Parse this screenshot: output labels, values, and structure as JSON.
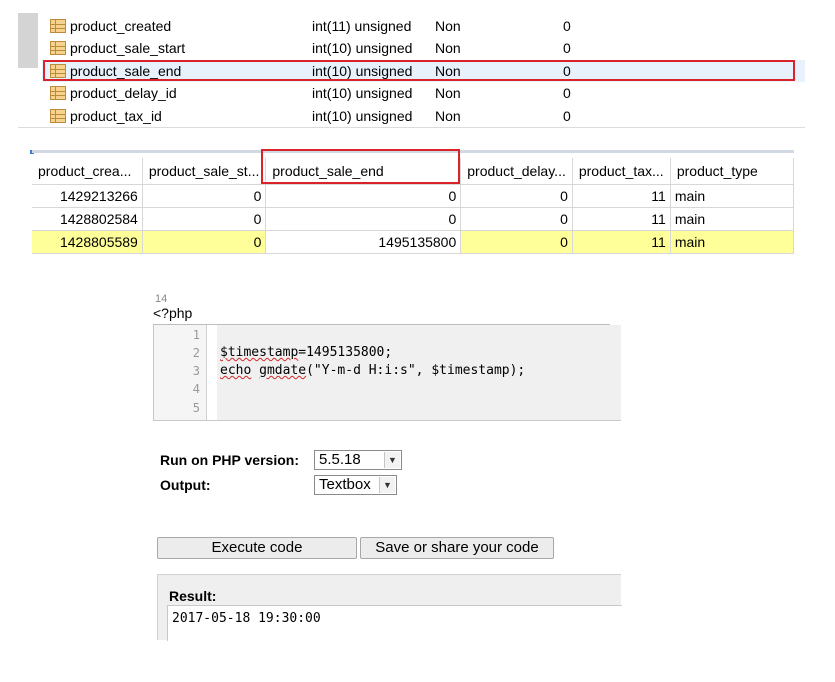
{
  "schema": {
    "rows": [
      {
        "name": "product_created",
        "type": "int(11) unsigned",
        "null": "Non",
        "default": "0"
      },
      {
        "name": "product_sale_start",
        "type": "int(10) unsigned",
        "null": "Non",
        "default": "0"
      },
      {
        "name": "product_sale_end",
        "type": "int(10) unsigned",
        "null": "Non",
        "default": "0"
      },
      {
        "name": "product_delay_id",
        "type": "int(10) unsigned",
        "null": "Non",
        "default": "0"
      },
      {
        "name": "product_tax_id",
        "type": "int(10) unsigned",
        "null": "Non",
        "default": "0"
      }
    ]
  },
  "grid": {
    "headers": [
      "product_crea...",
      "product_sale_st...",
      "product_sale_end",
      "product_delay...",
      "product_tax...",
      "product_type"
    ],
    "rows": [
      [
        "1429213266",
        "0",
        "0",
        "0",
        "11",
        "main"
      ],
      [
        "1428802584",
        "0",
        "0",
        "0",
        "11",
        "main"
      ],
      [
        "1428805589",
        "0",
        "1495135800",
        "0",
        "11",
        "main"
      ]
    ]
  },
  "php": {
    "tab_number": "14",
    "open_tag": "<?php",
    "line_numbers": [
      "1",
      "2",
      "3",
      "4",
      "5"
    ],
    "code_line_2_var": "$timestamp",
    "code_line_2_rest": "=1495135800;",
    "code_line_3_echo": "echo",
    "code_line_3_space": " ",
    "code_line_3_fn": "gmdate",
    "code_line_3_rest": "(\"Y-m-d H:i:s\", $timestamp);",
    "version_label": "Run on PHP version:",
    "version_value": "5.5.18",
    "output_label": "Output:",
    "output_value": "Textbox",
    "execute_label": "Execute code",
    "save_label": "Save or share your code",
    "result_label": "Result:",
    "result_text": "2017-05-18 19:30:00"
  },
  "colors": {
    "highlight_border": "#d8232a",
    "highlight_row": "#ffff99",
    "selected_row": "#e8f2fc"
  }
}
